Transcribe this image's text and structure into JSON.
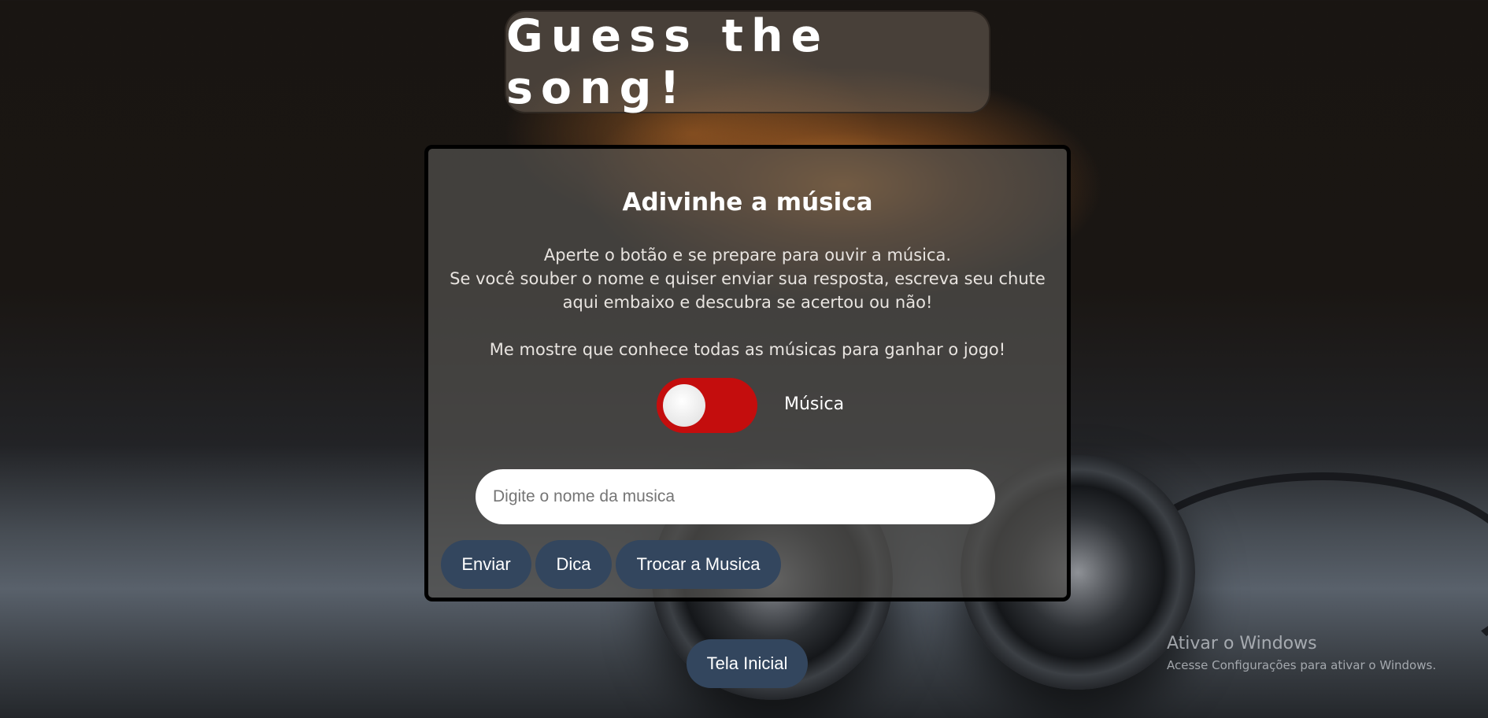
{
  "header": {
    "title": "Guess the song!"
  },
  "game_card": {
    "title": "Adivinhe a música",
    "instructions": [
      "Aperte o botão e se prepare para ouvir a música.",
      "Se você souber o nome e quiser enviar sua resposta, escreva seu chute aqui embaixo e descubra se acertou ou não!",
      "Me mostre que conhece todas as músicas para ganhar o jogo!"
    ],
    "toggle": {
      "label": "Música",
      "state": "off",
      "color": "#c40d0d"
    },
    "guess_input": {
      "value": "",
      "placeholder": "Digite o nome da musica"
    },
    "buttons": {
      "send": "Enviar",
      "hint": "Dica",
      "change_song": "Trocar a Musica"
    }
  },
  "footer": {
    "home_button": "Tela Inicial"
  },
  "os_watermark": {
    "title": "Ativar o Windows",
    "subtitle": "Acesse Configurações para ativar o Windows."
  },
  "colors": {
    "button_bg": "#33465e",
    "toggle_on_bg": "#c40d0d",
    "card_border": "#000000"
  }
}
